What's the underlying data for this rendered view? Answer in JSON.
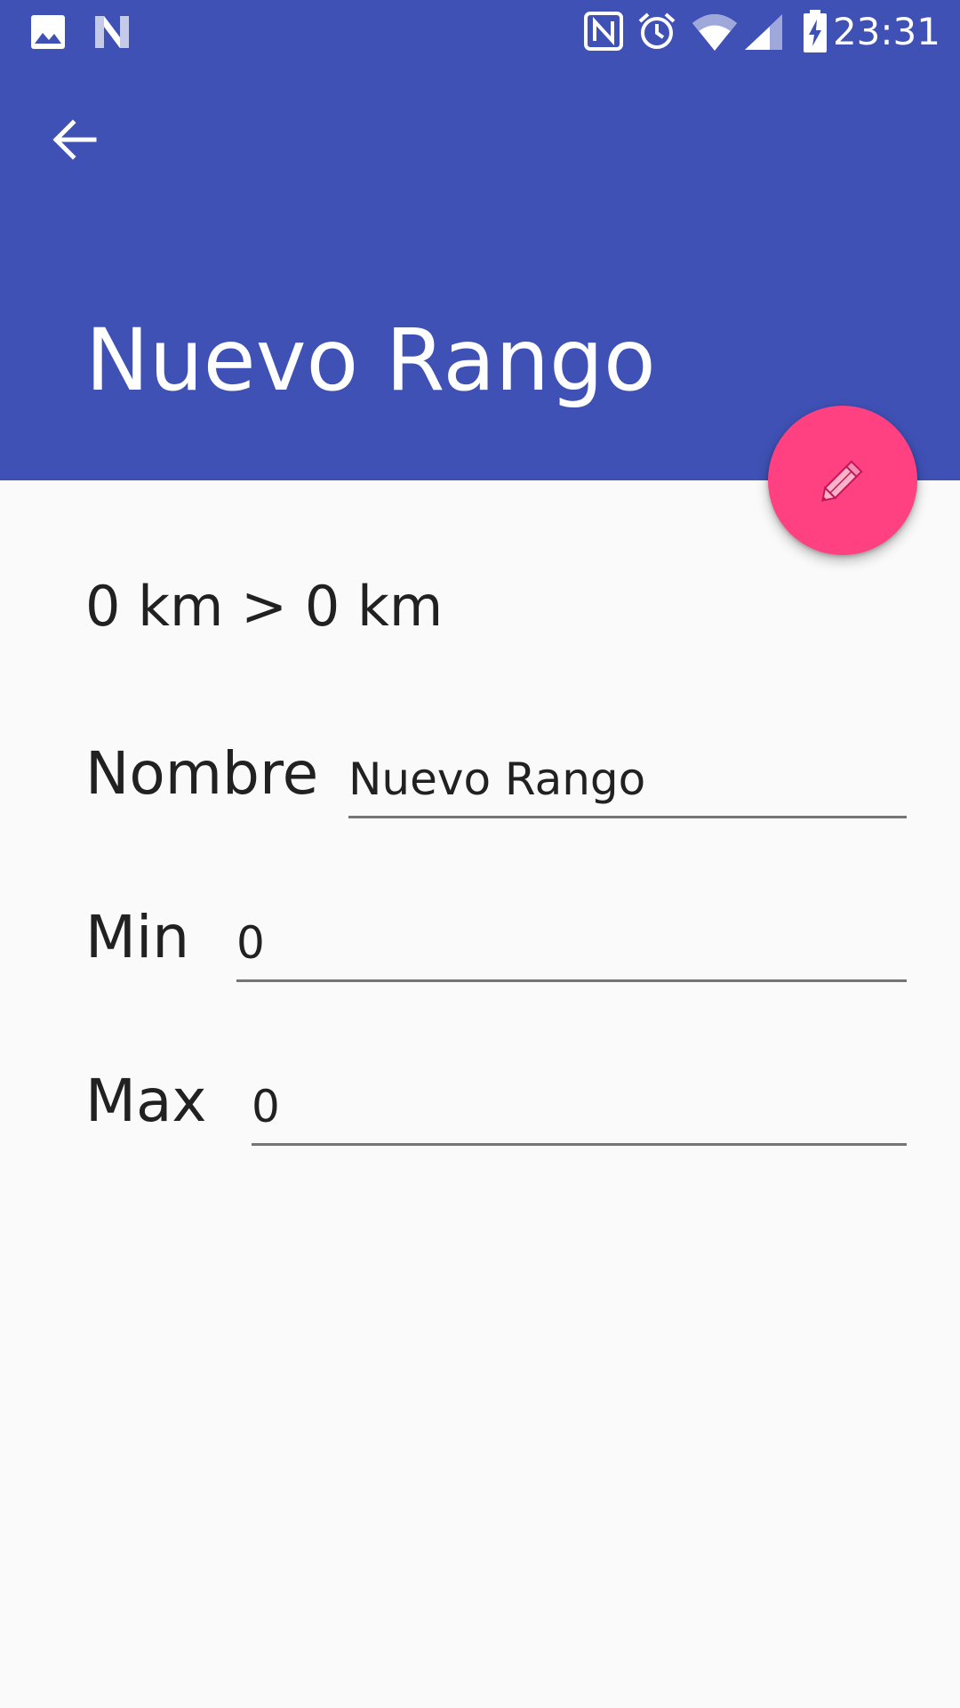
{
  "status_bar": {
    "time": "23:31",
    "icons": [
      "gallery-icon",
      "n-app-icon",
      "nfc-icon",
      "alarm-icon",
      "wifi-icon",
      "signal-icon",
      "battery-charging-icon"
    ]
  },
  "toolbar": {
    "back_icon": "arrow-back-icon",
    "title": "Nuevo Rango",
    "color": "#3f51b5"
  },
  "fab": {
    "icon": "pencil-icon",
    "color": "#ff4081"
  },
  "summary": {
    "text": "0 km > 0 km"
  },
  "form": {
    "nombre": {
      "label": "Nombre",
      "value": "Nuevo Rango"
    },
    "min": {
      "label": "Min",
      "value": "0"
    },
    "max": {
      "label": "Max",
      "value": "0"
    }
  }
}
